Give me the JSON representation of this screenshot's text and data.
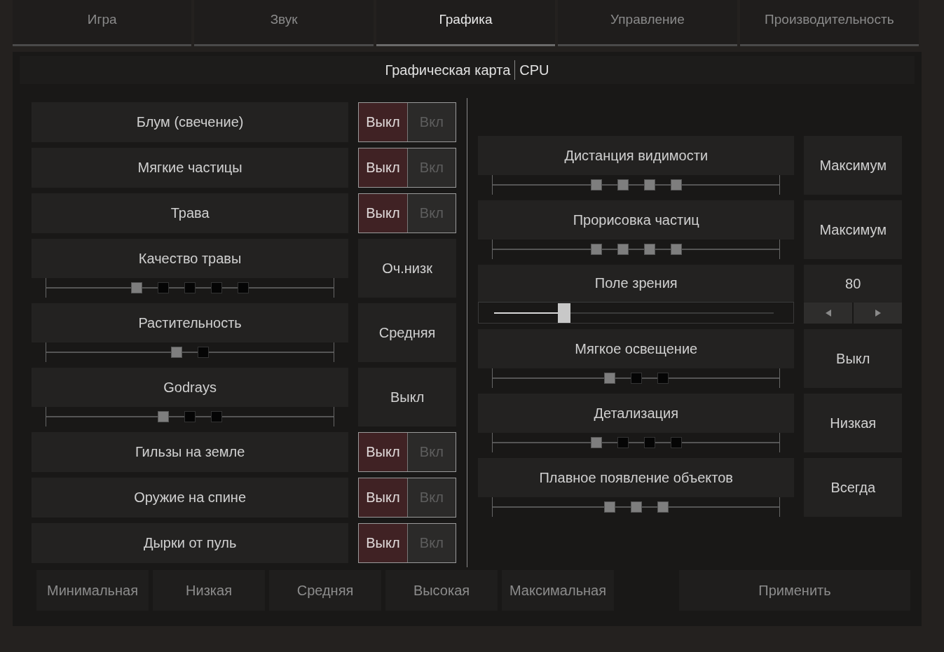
{
  "tabs": [
    {
      "label": "Игра",
      "selected": false
    },
    {
      "label": "Звук",
      "selected": false
    },
    {
      "label": "Графика",
      "selected": true
    },
    {
      "label": "Управление",
      "selected": false
    },
    {
      "label": "Производительность",
      "selected": false
    }
  ],
  "subtabs": [
    "Графическая карта",
    "CPU"
  ],
  "left": [
    {
      "kind": "toggle",
      "label": "Блум (свечение)",
      "options": [
        {
          "label": "Выкл",
          "selected": true
        },
        {
          "label": "Вкл",
          "selected": false
        }
      ]
    },
    {
      "kind": "toggle",
      "label": "Мягкие частицы",
      "options": [
        {
          "label": "Выкл",
          "selected": true
        },
        {
          "label": "Вкл",
          "selected": false
        }
      ]
    },
    {
      "kind": "toggle",
      "label": "Трава",
      "options": [
        {
          "label": "Выкл",
          "selected": true
        },
        {
          "label": "Вкл",
          "selected": false
        }
      ]
    },
    {
      "kind": "stepper",
      "label": "Качество травы",
      "value": "Оч.низк",
      "steps": [
        {
          "on": true
        },
        {
          "on": false
        },
        {
          "on": false
        },
        {
          "on": false
        },
        {
          "on": false
        }
      ]
    },
    {
      "kind": "stepper",
      "label": "Растительность",
      "value": "Средняя",
      "steps": [
        {
          "on": true
        },
        {
          "on": false
        }
      ]
    },
    {
      "kind": "stepper",
      "label": "Godrays",
      "value": "Выкл",
      "steps": [
        {
          "on": true
        },
        {
          "on": false
        },
        {
          "on": false
        }
      ]
    },
    {
      "kind": "toggle",
      "label": "Гильзы на земле",
      "options": [
        {
          "label": "Выкл",
          "selected": true
        },
        {
          "label": "Вкл",
          "selected": false
        }
      ]
    },
    {
      "kind": "toggle",
      "label": "Оружие на спине",
      "options": [
        {
          "label": "Выкл",
          "selected": true
        },
        {
          "label": "Вкл",
          "selected": false
        }
      ]
    },
    {
      "kind": "toggle",
      "label": "Дырки от пуль",
      "options": [
        {
          "label": "Выкл",
          "selected": true
        },
        {
          "label": "Вкл",
          "selected": false
        }
      ]
    }
  ],
  "right": [
    {
      "kind": "stepper",
      "label": "Дистанция видимости",
      "value": "Максимум",
      "steps": [
        {
          "on": true
        },
        {
          "on": true
        },
        {
          "on": true
        },
        {
          "on": true
        }
      ]
    },
    {
      "kind": "stepper",
      "label": "Прорисовка частиц",
      "value": "Максимум",
      "steps": [
        {
          "on": true
        },
        {
          "on": true
        },
        {
          "on": true
        },
        {
          "on": true
        }
      ]
    },
    {
      "kind": "slider",
      "label": "Поле зрения",
      "value": "80",
      "level": 0.25
    },
    {
      "kind": "stepper",
      "label": "Мягкое освещение",
      "value": "Выкл",
      "steps": [
        {
          "on": true
        },
        {
          "on": false
        },
        {
          "on": false
        }
      ]
    },
    {
      "kind": "stepper",
      "label": "Детализация",
      "value": "Низкая",
      "steps": [
        {
          "on": true
        },
        {
          "on": false
        },
        {
          "on": false
        },
        {
          "on": false
        }
      ]
    },
    {
      "kind": "stepper",
      "label": "Плавное появление объектов",
      "value": "Всегда",
      "steps": [
        {
          "on": true
        },
        {
          "on": true
        },
        {
          "on": true
        }
      ]
    }
  ],
  "presets": [
    "Минимальная",
    "Низкая",
    "Средняя",
    "Высокая",
    "Максимальная"
  ],
  "apply": "Применить"
}
